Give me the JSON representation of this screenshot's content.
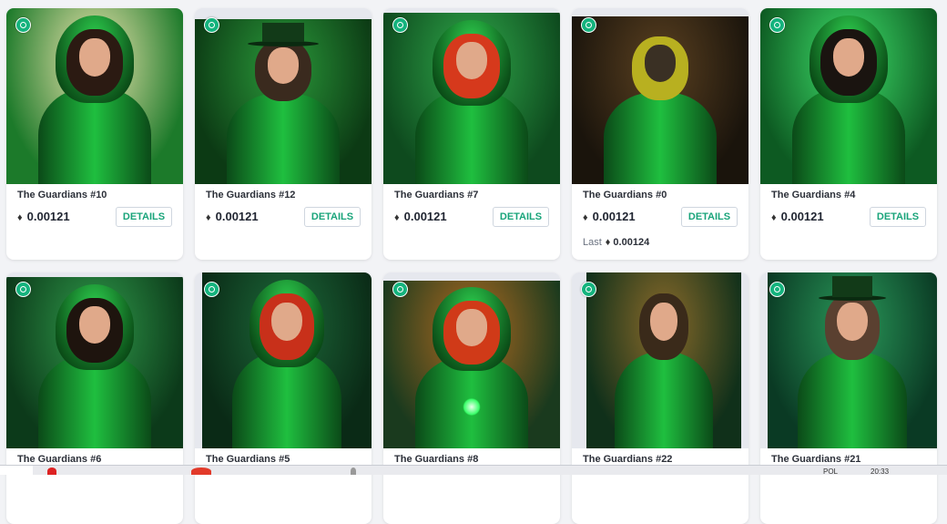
{
  "eth_symbol": "♦",
  "details_label": "DETAILS",
  "last_label": "Last",
  "cards": [
    {
      "name": "The Guardians #10",
      "price": "0.00121",
      "subject": "hooded-woman",
      "bg1": "#f0e6b0",
      "bg2": "#1c7a2a",
      "hair": "#2b1a12"
    },
    {
      "name": "The Guardians #12",
      "price": "0.00121",
      "subject": "top-hat-man",
      "bg1": "#2a9a3a",
      "bg2": "#0c3a14",
      "hair": "#3a2a1e"
    },
    {
      "name": "The Guardians #7",
      "price": "0.00121",
      "subject": "hooded-redhead",
      "bg1": "#2fa84a",
      "bg2": "#0e4a1e",
      "hair": "#d6391c"
    },
    {
      "name": "The Guardians #0",
      "price": "0.00121",
      "last": "0.00124",
      "subject": "baboon-suit",
      "bg1": "#5a4020",
      "bg2": "#1a140c",
      "hair": "#b8b020"
    },
    {
      "name": "The Guardians #4",
      "price": "0.00121",
      "subject": "green-woman",
      "bg1": "#3ee06a",
      "bg2": "#0d5a22",
      "hair": "#1a1410"
    },
    {
      "name": "The Guardians #6",
      "subject": "hooded-woman",
      "bg1": "#2f9a4a",
      "bg2": "#0c3a1a",
      "hair": "#1e140e"
    },
    {
      "name": "The Guardians #5",
      "subject": "hooded-redhead",
      "bg1": "#1d6a3a",
      "bg2": "#0a2a16",
      "hair": "#c8301a"
    },
    {
      "name": "The Guardians #8",
      "subject": "hooded-redhead",
      "bg1": "#b06a20",
      "bg2": "#1a3a1e",
      "hair": "#d03a18"
    },
    {
      "name": "The Guardians #22",
      "subject": "seated-man",
      "bg1": "#8a6a2a",
      "bg2": "#10301a",
      "hair": "#3a2a1a"
    },
    {
      "name": "The Guardians #21",
      "subject": "top-hat-man",
      "bg1": "#2a9a5a",
      "bg2": "#0a3a24",
      "hair": "#5a4030"
    }
  ],
  "taskbar": {
    "lang": "POL",
    "time": "20:33"
  }
}
